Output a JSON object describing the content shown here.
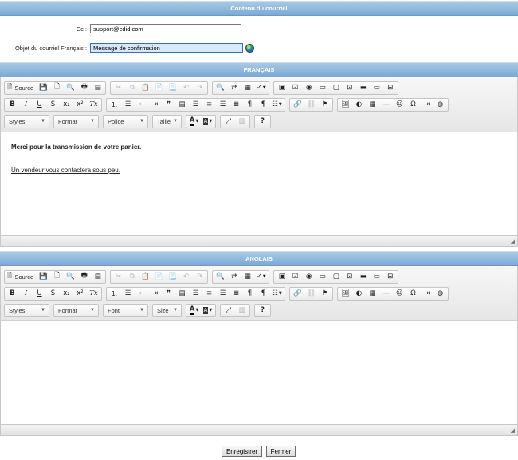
{
  "header": {
    "title": "Contenu du courriel"
  },
  "form": {
    "cc_label": "Cc :",
    "cc_value": "support@cdid.com",
    "subject_label": "Objet du courriel Français :",
    "subject_value": "Message de confirmation"
  },
  "editor_fr": {
    "title": "FRANÇAIS",
    "source_label": "Source",
    "combos": {
      "styles": "Styles",
      "format": "Format",
      "font": "Police",
      "size": "Taille"
    },
    "content": {
      "line1": "Merci pour la transmission de votre panier.",
      "line2": "Un vendeur vous contactera sous peu."
    }
  },
  "editor_en": {
    "title": "ANGLAIS",
    "source_label": "Source",
    "combos": {
      "styles": "Styles",
      "format": "Format",
      "font": "Font",
      "size": "Size"
    }
  },
  "toolbar_common": {
    "bold": "B",
    "italic": "I",
    "underline": "U",
    "strike": "S",
    "subscript": "x₂",
    "superscript": "x²",
    "remove_format": "Tx",
    "blockquote": "❞",
    "help": "?",
    "color_text": "A",
    "color_bg": "A"
  },
  "footer": {
    "save_label": "Enregistrer",
    "close_label": "Fermer"
  }
}
